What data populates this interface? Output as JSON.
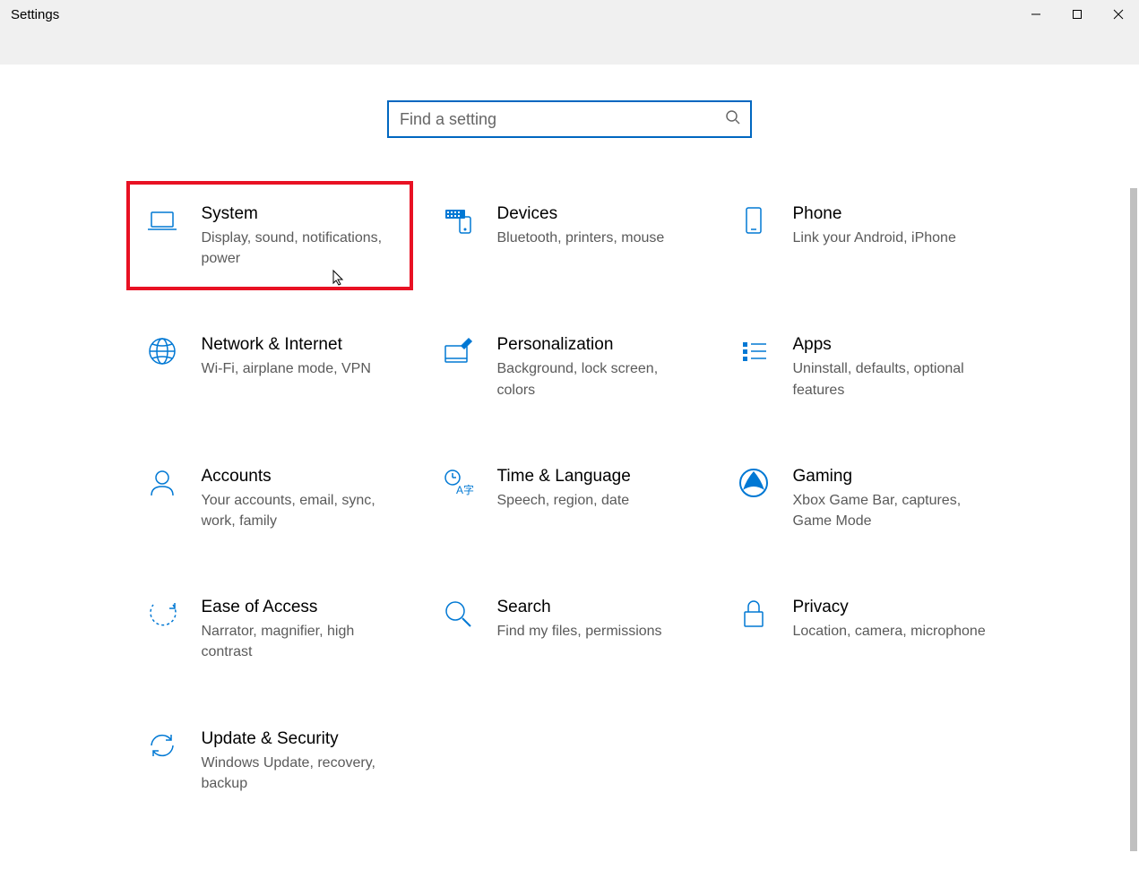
{
  "window": {
    "title": "Settings"
  },
  "search": {
    "placeholder": "Find a setting"
  },
  "tiles": [
    {
      "title": "System",
      "desc": "Display, sound, notifications, power",
      "icon": "laptop-icon",
      "highlight": true
    },
    {
      "title": "Devices",
      "desc": "Bluetooth, printers, mouse",
      "icon": "devices-icon"
    },
    {
      "title": "Phone",
      "desc": "Link your Android, iPhone",
      "icon": "phone-icon"
    },
    {
      "title": "Network & Internet",
      "desc": "Wi-Fi, airplane mode, VPN",
      "icon": "globe-icon"
    },
    {
      "title": "Personalization",
      "desc": "Background, lock screen, colors",
      "icon": "personalization-icon"
    },
    {
      "title": "Apps",
      "desc": "Uninstall, defaults, optional features",
      "icon": "apps-icon"
    },
    {
      "title": "Accounts",
      "desc": "Your accounts, email, sync, work, family",
      "icon": "person-icon"
    },
    {
      "title": "Time & Language",
      "desc": "Speech, region, date",
      "icon": "time-language-icon"
    },
    {
      "title": "Gaming",
      "desc": "Xbox Game Bar, captures, Game Mode",
      "icon": "gaming-icon"
    },
    {
      "title": "Ease of Access",
      "desc": "Narrator, magnifier, high contrast",
      "icon": "ease-of-access-icon"
    },
    {
      "title": "Search",
      "desc": "Find my files, permissions",
      "icon": "search-tile-icon"
    },
    {
      "title": "Privacy",
      "desc": "Location, camera, microphone",
      "icon": "lock-icon"
    },
    {
      "title": "Update & Security",
      "desc": "Windows Update, recovery, backup",
      "icon": "update-icon"
    }
  ]
}
